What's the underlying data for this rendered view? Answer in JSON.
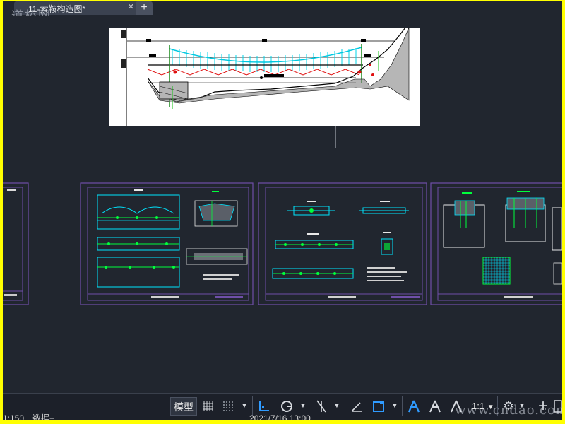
{
  "window": {
    "tab_title": "11-索鞍构造图*",
    "tab_close_glyph": "✕",
    "new_tab_glyph": "+",
    "watermark_top": "道桥网",
    "watermark_bottom": "www.cndao.com"
  },
  "colors": {
    "frame": "#ffff00",
    "canvas_bg": "#21262f",
    "sheet_border": "#6f4fa8",
    "cad_cyan": "#00e5ff",
    "cad_green": "#00ff3c",
    "cad_red": "#ff2020",
    "cad_white": "#e8e8e8"
  },
  "statusbar": {
    "left_text": "1:150　数据+　　　　　　　　　　　　　　　　　　　　　　　2021/7/16 13:00",
    "model_label": "模型",
    "grid_icon": "grid-icon",
    "snap_icon": "snap-icon",
    "ortho_icon": "ortho-icon",
    "polar_icon": "polar-icon",
    "isometric_icon": "isometric-icon",
    "osnap_icon": "osnap-icon",
    "annotation_icon": "annotation-icon",
    "scale_label": "1:1",
    "settings_icon": "gear-icon",
    "plus_icon": "plus-icon"
  }
}
